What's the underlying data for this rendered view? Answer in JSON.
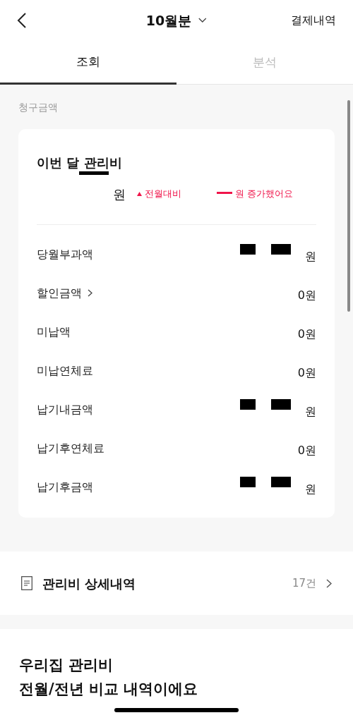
{
  "header": {
    "title": "10월분",
    "action": "결제내역"
  },
  "tabs": [
    {
      "label": "조회",
      "selected": true
    },
    {
      "label": "분석",
      "selected": false
    }
  ],
  "section_label": "청구금액",
  "summary": {
    "title": "이번 달 관리비",
    "amount": "원",
    "comparison_prefix": "전월대비",
    "comparison_suffix": "원 증가했어요",
    "comparison_redacted": true
  },
  "rows": [
    {
      "label": "당월부과액",
      "value": "원",
      "redacted": true,
      "has_arrow": false
    },
    {
      "label": "할인금액",
      "value": "0원",
      "redacted": false,
      "has_arrow": true
    },
    {
      "label": "미납액",
      "value": "0원",
      "redacted": false,
      "has_arrow": false
    },
    {
      "label": "미납연체료",
      "value": "0원",
      "redacted": false,
      "has_arrow": false
    },
    {
      "label": "납기내금액",
      "value": "원",
      "redacted": true,
      "has_arrow": false
    },
    {
      "label": "납기후연체료",
      "value": "0원",
      "redacted": false,
      "has_arrow": false
    },
    {
      "label": "납기후금액",
      "value": "원",
      "redacted": true,
      "has_arrow": false
    }
  ],
  "detail_link": {
    "label": "관리비 상세내역",
    "count": "17건"
  },
  "comparison_heading": [
    "우리집 관리비",
    "전월/전년 비교 내역이에요"
  ]
}
